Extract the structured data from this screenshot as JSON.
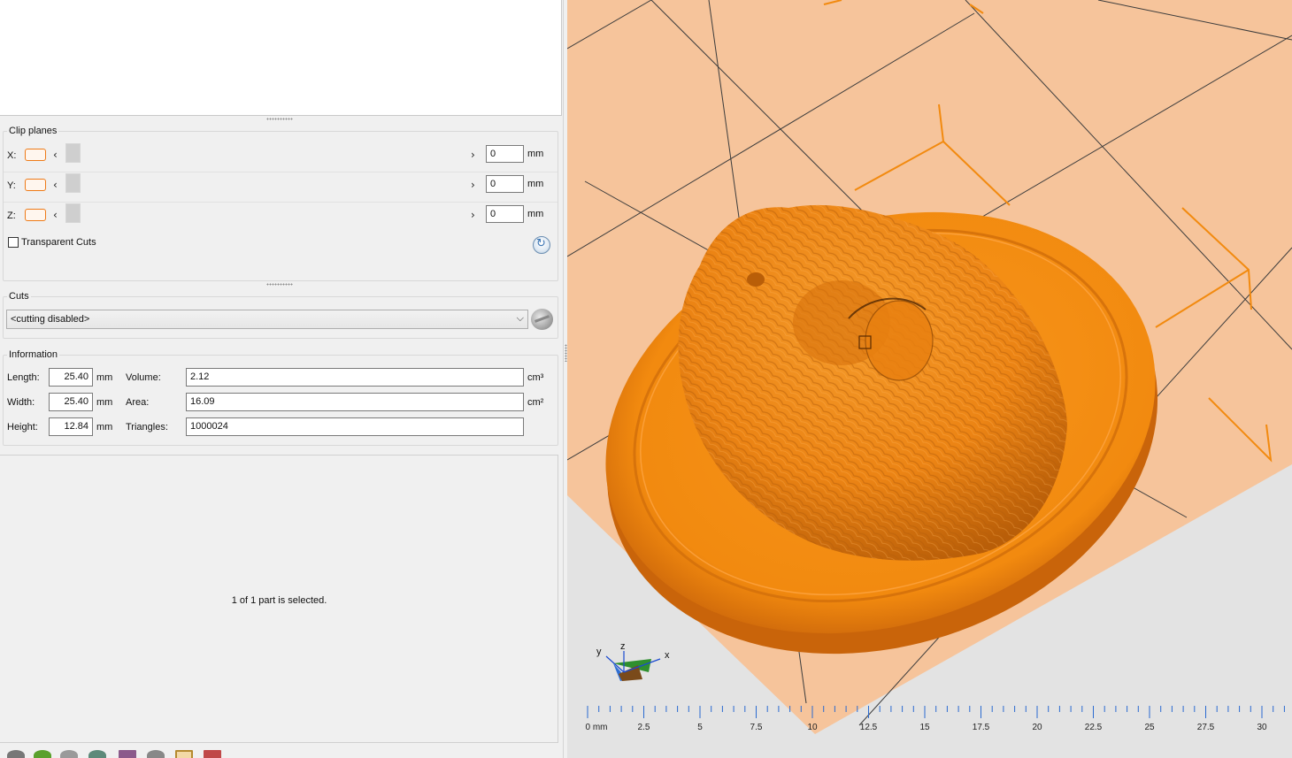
{
  "clip_planes": {
    "title": "Clip planes",
    "rows": [
      {
        "axis": "X:",
        "value": "0",
        "unit": "mm"
      },
      {
        "axis": "Y:",
        "value": "0",
        "unit": "mm"
      },
      {
        "axis": "Z:",
        "value": "0",
        "unit": "mm"
      }
    ],
    "transparent_cuts_label": "Transparent Cuts",
    "transparent_cuts_checked": false
  },
  "cuts": {
    "title": "Cuts",
    "selected": "<cutting disabled>"
  },
  "information": {
    "title": "Information",
    "length_label": "Length:",
    "length_value": "25.40",
    "length_unit": "mm",
    "width_label": "Width:",
    "width_value": "25.40",
    "width_unit": "mm",
    "height_label": "Height:",
    "height_value": "12.84",
    "height_unit": "mm",
    "volume_label": "Volume:",
    "volume_value": "2.12",
    "volume_unit": "cm³",
    "area_label": "Area:",
    "area_value": "16.09",
    "area_unit": "cm²",
    "triangles_label": "Triangles:",
    "triangles_value": "1000024"
  },
  "selection_status": "1 of 1 part is selected.",
  "viewport": {
    "model_color": "#f28a0f",
    "platform_color": "#f6c49b",
    "background_color": "#e3e3e3",
    "triad": {
      "x": "x",
      "y": "y",
      "z": "z"
    },
    "ruler": {
      "labels": [
        "0 mm",
        "2.5",
        "5",
        "7.5",
        "10",
        "12.5",
        "15",
        "17.5",
        "20",
        "22.5",
        "25",
        "27.5",
        "30"
      ]
    }
  }
}
